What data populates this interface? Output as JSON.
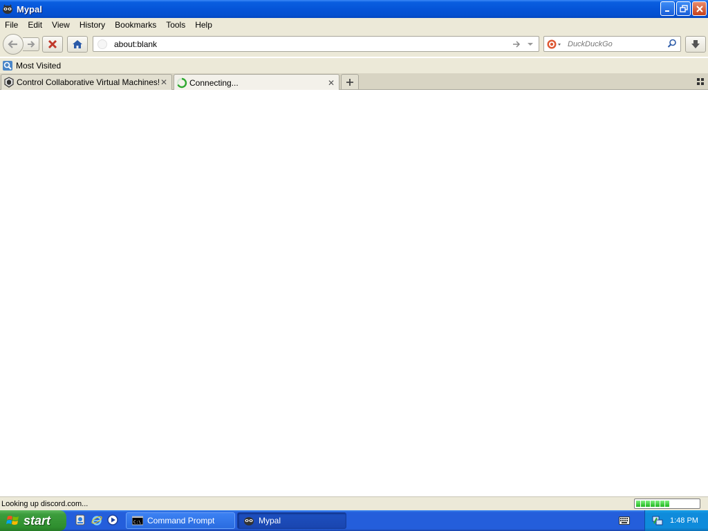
{
  "window": {
    "title": "Mypal",
    "app_icon": "mypal-raccoon-icon"
  },
  "menu": {
    "items": [
      "File",
      "Edit",
      "View",
      "History",
      "Bookmarks",
      "Tools",
      "Help"
    ]
  },
  "toolbar": {
    "back_icon": "arrow-left-icon",
    "forward_icon": "arrow-right-icon",
    "stop_icon": "stop-x-icon",
    "home_icon": "home-icon",
    "download_icon": "download-arrow-icon"
  },
  "urlbar": {
    "value": "about:blank"
  },
  "search": {
    "placeholder": "DuckDuckGo",
    "engine_icon": "duckduckgo-icon"
  },
  "bookmarks": {
    "items": [
      {
        "label": "Most Visited",
        "icon": "most-visited-icon"
      }
    ]
  },
  "tabs": [
    {
      "label": "Control Collaborative Virtual Machines!",
      "icon": "collabvm-icon",
      "selected": false
    },
    {
      "label": "Connecting...",
      "icon": "loading-spinner-icon",
      "selected": true
    }
  ],
  "status": {
    "text": "Looking up discord.com...",
    "progress_fraction": 0.5
  },
  "taskbar": {
    "start_label": "start",
    "quick_launch": [
      "messenger-icon",
      "internet-explorer-icon",
      "media-player-icon"
    ],
    "tasks": [
      {
        "label": "Command Prompt",
        "icon": "command-prompt-icon",
        "active": false
      },
      {
        "label": "Mypal",
        "icon": "mypal-raccoon-icon",
        "active": true
      }
    ],
    "clock": "1:48 PM"
  },
  "colors": {
    "xp_blue": "#245edb",
    "start_green": "#3c9c3c",
    "progress_green": "#1fb71f",
    "chrome_beige": "#ece9d8"
  }
}
